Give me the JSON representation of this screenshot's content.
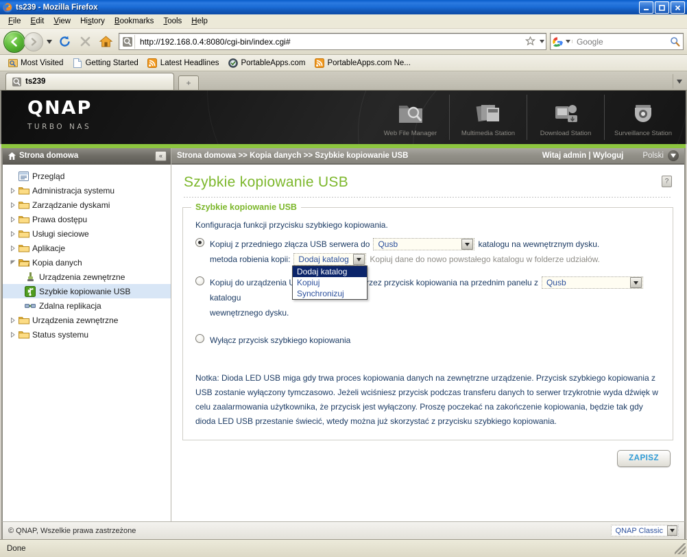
{
  "window": {
    "title": "ts239 - Mozilla Firefox",
    "controls": {
      "minimize": "_",
      "maximize": "□",
      "close": "✕"
    }
  },
  "menubar": {
    "items": [
      "File",
      "Edit",
      "View",
      "History",
      "Bookmarks",
      "Tools",
      "Help"
    ]
  },
  "toolbar": {
    "url": "http://192.168.0.4:8080/cgi-bin/index.cgi#",
    "search_engine": "Google",
    "search_placeholder": "Google",
    "icons": [
      "back-icon",
      "forward-icon",
      "reload-icon",
      "stop-icon",
      "home-icon"
    ]
  },
  "bookmarks": {
    "items": [
      {
        "label": "Most Visited",
        "icon": "most-visited-icon"
      },
      {
        "label": "Getting Started",
        "icon": "page-icon"
      },
      {
        "label": "Latest Headlines",
        "icon": "rss-icon"
      },
      {
        "label": "PortableApps.com",
        "icon": "portableapps-icon"
      },
      {
        "label": "PortableApps.com Ne...",
        "icon": "rss-icon"
      }
    ]
  },
  "tabs": {
    "items": [
      {
        "label": "ts239",
        "active": true
      }
    ],
    "new_tab_label": "+",
    "list_caret": "▾"
  },
  "banner": {
    "logo": "QNAP",
    "tagline": "TURBO NAS",
    "stations": [
      {
        "label": "Web File Manager",
        "icon": "folder-search-icon"
      },
      {
        "label": "Multimedia Station",
        "icon": "multimedia-icon"
      },
      {
        "label": "Download Station",
        "icon": "download-icon"
      },
      {
        "label": "Surveillance Station",
        "icon": "camera-icon"
      }
    ]
  },
  "sidebar": {
    "header": "Strona domowa",
    "collapse_label": "«",
    "items": [
      {
        "label": "Przegląd",
        "icon": "overview-icon",
        "expandable": false,
        "level": 0
      },
      {
        "label": "Administracja systemu",
        "icon": "folder-icon",
        "expandable": true,
        "level": 0
      },
      {
        "label": "Zarządzanie dyskami",
        "icon": "folder-icon",
        "expandable": true,
        "level": 0
      },
      {
        "label": "Prawa dostępu",
        "icon": "folder-icon",
        "expandable": true,
        "level": 0
      },
      {
        "label": "Usługi sieciowe",
        "icon": "folder-icon",
        "expandable": true,
        "level": 0
      },
      {
        "label": "Aplikacje",
        "icon": "folder-icon",
        "expandable": true,
        "level": 0
      },
      {
        "label": "Kopia danych",
        "icon": "folder-open-icon",
        "expanded": true,
        "level": 0
      },
      {
        "label": "Urządzenia zewnętrzne",
        "icon": "usb-device-icon",
        "level": 1
      },
      {
        "label": "Szybkie kopiowanie USB",
        "icon": "usb-green-icon",
        "level": 1,
        "selected": true
      },
      {
        "label": "Zdalna replikacja",
        "icon": "replication-icon",
        "level": 1
      },
      {
        "label": "Urządzenia zewnętrzne",
        "icon": "folder-icon",
        "expandable": true,
        "level": 0
      },
      {
        "label": "Status systemu",
        "icon": "folder-icon",
        "expandable": true,
        "level": 0
      }
    ]
  },
  "breadcrumb": {
    "path": "Strona domowa >> Kopia danych >> Szybkie kopiowanie USB",
    "welcome": "Witaj admin | Wyloguj",
    "language": "Polski"
  },
  "page": {
    "title": "Szybkie kopiowanie USB",
    "help_label": "?"
  },
  "form": {
    "legend": "Szybkie kopiowanie USB",
    "intro": "Konfiguracja funkcji przycisku szybkiego kopiowania.",
    "option1": {
      "selected": true,
      "text_before": "Kopiuj z przedniego złącza USB serwera do",
      "target_value": "Qusb",
      "text_after": "katalogu na wewnętrznym dysku.",
      "method_label": "metoda robienia kopii:",
      "method_value": "Dodaj katalog",
      "method_hint": "Kopiuj dane do nowo powstałego katalogu w folderze udziałów.",
      "method_options": [
        "Dodaj katalog",
        "Kopiuj",
        "Synchronizuj"
      ],
      "method_open": true,
      "method_selected_index": 0
    },
    "option2": {
      "selected": false,
      "text_before": "Kopiuj do urządzenia USB podłączonego przez przycisk kopiowania na przednim panelu z",
      "source_value": "Qusb",
      "text_after": "katalogu",
      "text_line2": "wewnętrznego dysku."
    },
    "option3": {
      "selected": false,
      "text": "Wyłącz przycisk szybkiego kopiowania"
    },
    "note": "Notka: Dioda LED USB miga gdy trwa proces kopiowania danych na zewnętrzne urządzenie. Przycisk szybkiego kopiowania z USB zostanie wyłączony tymczasowo. Jeżeli wciśniesz przycisk podczas transferu danych to serwer trzykrotnie wyda dźwięk w celu zaalarmowania użytkownika, że przycisk jest wyłączony. Proszę poczekać na zakończenie kopiowania, będzie tak gdy dioda LED USB przestanie świecić, wtedy można już skorzystać z przycisku szybkiego kopiowania.",
    "save_button": "ZAPISZ"
  },
  "footer": {
    "copyright": "© QNAP, Wszelkie prawa zastrzeżone",
    "theme": "QNAP Classic"
  },
  "statusbar": {
    "text": "Done"
  },
  "colors": {
    "qnap_green": "#8dc63f",
    "title_green": "#7cb72b",
    "text_blue": "#1b3a63",
    "link_blue": "#2b4f9c",
    "save_blue": "#2f9bd6",
    "selection_blue": "#0b246a",
    "sidebar_selected": "#d8e6f6"
  }
}
